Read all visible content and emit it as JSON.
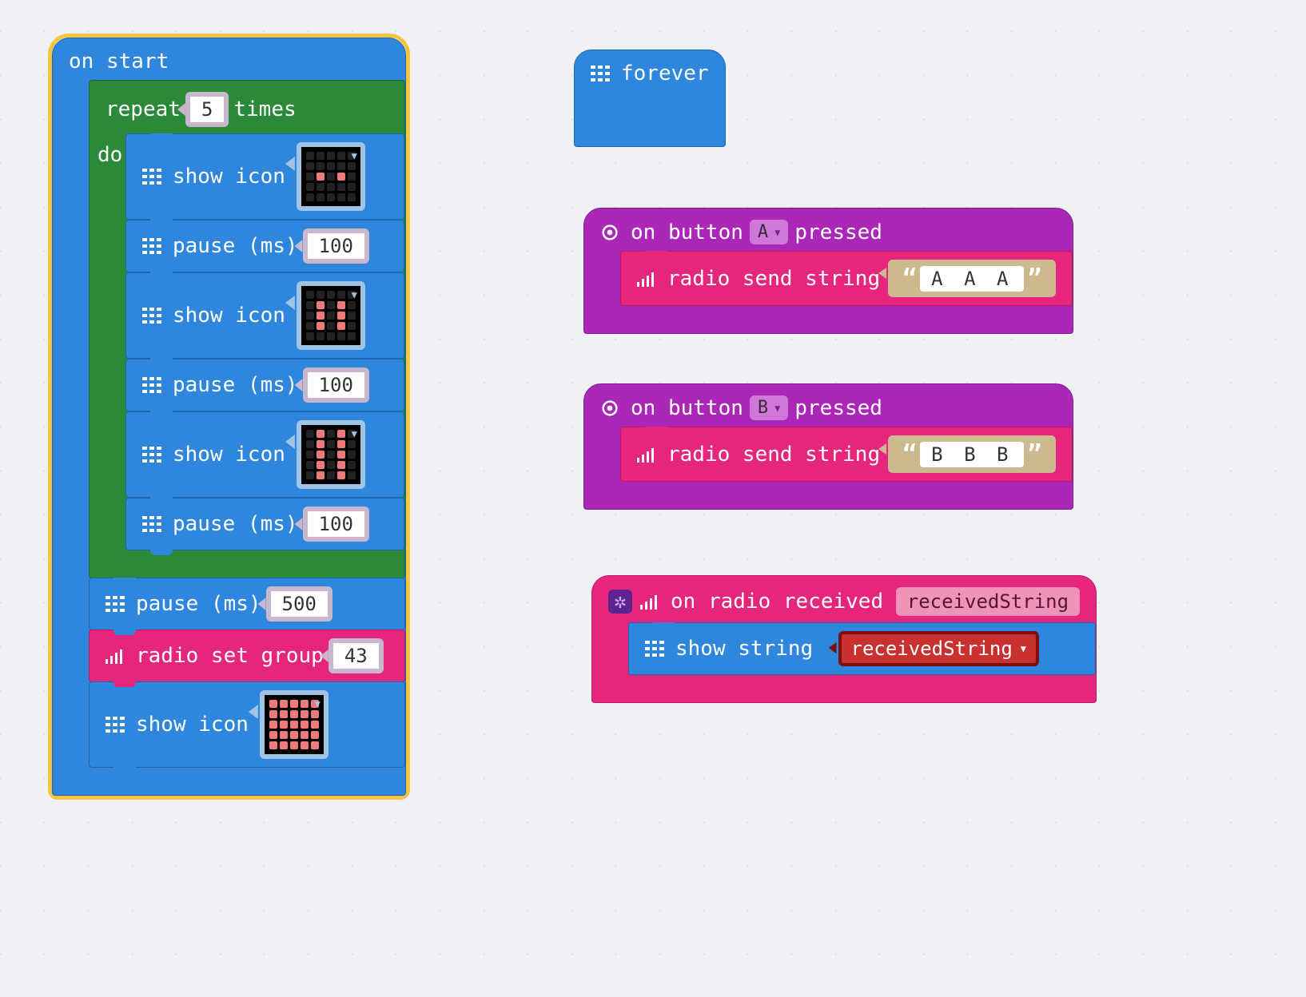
{
  "main": {
    "onStart": {
      "label": "on start",
      "repeat": {
        "label_a": "repeat",
        "count": "5",
        "label_b": "times",
        "do_label": "do",
        "body": [
          {
            "type": "showicon",
            "label": "show icon",
            "pattern": [
              0,
              0,
              0,
              0,
              0,
              0,
              0,
              0,
              0,
              0,
              0,
              1,
              0,
              1,
              0,
              0,
              0,
              0,
              0,
              0,
              0,
              0,
              0,
              0,
              0
            ]
          },
          {
            "type": "pause",
            "label": "pause (ms)",
            "value": "100"
          },
          {
            "type": "showicon",
            "label": "show icon",
            "pattern": [
              0,
              0,
              0,
              0,
              0,
              0,
              1,
              0,
              1,
              0,
              0,
              1,
              0,
              1,
              0,
              0,
              1,
              0,
              1,
              0,
              0,
              0,
              0,
              0,
              0
            ]
          },
          {
            "type": "pause",
            "label": "pause (ms)",
            "value": "100"
          },
          {
            "type": "showicon",
            "label": "show icon",
            "pattern": [
              0,
              1,
              0,
              1,
              0,
              0,
              1,
              0,
              1,
              0,
              0,
              1,
              0,
              1,
              0,
              0,
              1,
              0,
              1,
              0,
              0,
              1,
              0,
              1,
              0
            ]
          },
          {
            "type": "pause",
            "label": "pause (ms)",
            "value": "100"
          }
        ]
      },
      "tail": [
        {
          "type": "pause",
          "label": "pause (ms)",
          "value": "500",
          "color": "blue"
        },
        {
          "type": "radio",
          "label": "radio set group",
          "value": "43",
          "color": "pink"
        },
        {
          "type": "showicon",
          "label": "show icon",
          "pattern": [
            1,
            1,
            1,
            1,
            1,
            1,
            1,
            1,
            1,
            1,
            1,
            1,
            1,
            1,
            1,
            1,
            1,
            1,
            1,
            1,
            1,
            1,
            1,
            1,
            1
          ],
          "color": "blue"
        }
      ]
    }
  },
  "forever": {
    "label": "forever"
  },
  "btnA": {
    "on_a": "on button",
    "btn": "A",
    "on_b": "pressed",
    "send_label": "radio send string",
    "value": "A A A"
  },
  "btnB": {
    "on_a": "on button",
    "btn": "B",
    "on_b": "pressed",
    "send_label": "radio send string",
    "value": "B B B"
  },
  "radioRx": {
    "on": "on radio received",
    "param": "receivedString",
    "show_label": "show string",
    "var": "receivedString"
  }
}
